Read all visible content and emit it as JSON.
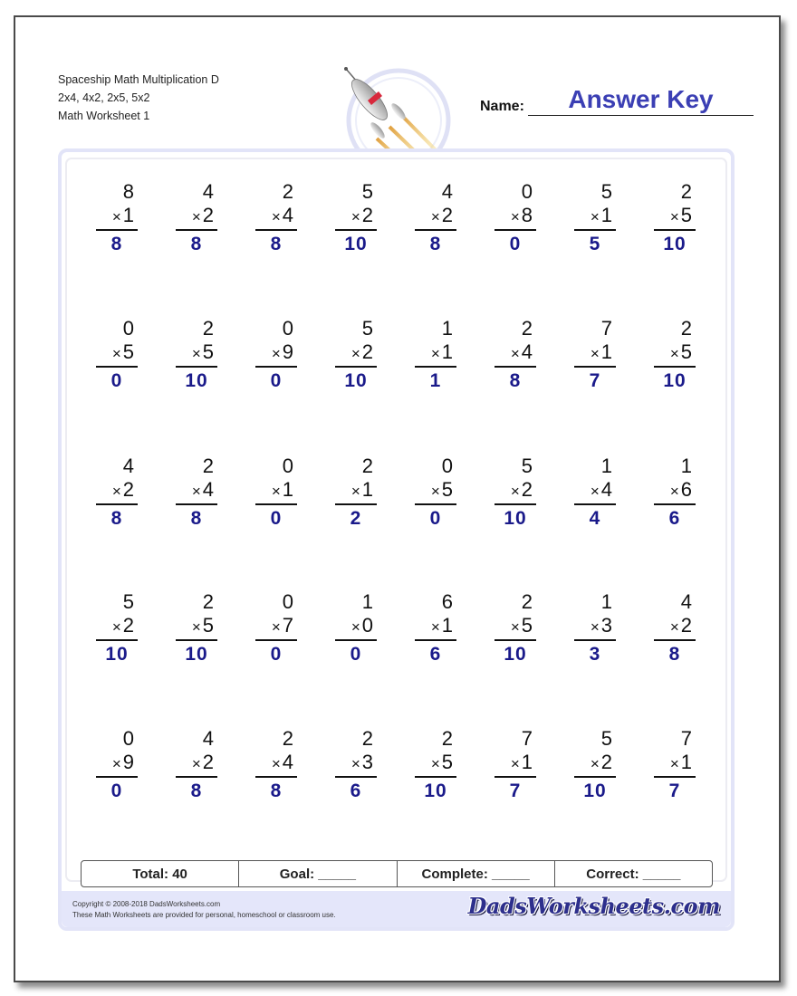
{
  "header": {
    "title": "Spaceship Math Multiplication D",
    "facts": "2x4, 4x2, 2x5, 5x2",
    "subtitle": "Math Worksheet 1",
    "name_label": "Name:",
    "name_value": "Answer Key"
  },
  "colors": {
    "answer": "#1a1a8a",
    "name_value": "#3b3fb4",
    "panel_border": "#e2e4f8",
    "footer_band": "#e4e6fa"
  },
  "operator": "×",
  "problems": [
    [
      {
        "a": "8",
        "b": "1",
        "ans": "8"
      },
      {
        "a": "4",
        "b": "2",
        "ans": "8"
      },
      {
        "a": "2",
        "b": "4",
        "ans": "8"
      },
      {
        "a": "5",
        "b": "2",
        "ans": "10"
      },
      {
        "a": "4",
        "b": "2",
        "ans": "8"
      },
      {
        "a": "0",
        "b": "8",
        "ans": "0"
      },
      {
        "a": "5",
        "b": "1",
        "ans": "5"
      },
      {
        "a": "2",
        "b": "5",
        "ans": "10"
      }
    ],
    [
      {
        "a": "0",
        "b": "5",
        "ans": "0"
      },
      {
        "a": "2",
        "b": "5",
        "ans": "10"
      },
      {
        "a": "0",
        "b": "9",
        "ans": "0"
      },
      {
        "a": "5",
        "b": "2",
        "ans": "10"
      },
      {
        "a": "1",
        "b": "1",
        "ans": "1"
      },
      {
        "a": "2",
        "b": "4",
        "ans": "8"
      },
      {
        "a": "7",
        "b": "1",
        "ans": "7"
      },
      {
        "a": "2",
        "b": "5",
        "ans": "10"
      }
    ],
    [
      {
        "a": "4",
        "b": "2",
        "ans": "8"
      },
      {
        "a": "2",
        "b": "4",
        "ans": "8"
      },
      {
        "a": "0",
        "b": "1",
        "ans": "0"
      },
      {
        "a": "2",
        "b": "1",
        "ans": "2"
      },
      {
        "a": "0",
        "b": "5",
        "ans": "0"
      },
      {
        "a": "5",
        "b": "2",
        "ans": "10"
      },
      {
        "a": "1",
        "b": "4",
        "ans": "4"
      },
      {
        "a": "1",
        "b": "6",
        "ans": "6"
      }
    ],
    [
      {
        "a": "5",
        "b": "2",
        "ans": "10"
      },
      {
        "a": "2",
        "b": "5",
        "ans": "10"
      },
      {
        "a": "0",
        "b": "7",
        "ans": "0"
      },
      {
        "a": "1",
        "b": "0",
        "ans": "0"
      },
      {
        "a": "6",
        "b": "1",
        "ans": "6"
      },
      {
        "a": "2",
        "b": "5",
        "ans": "10"
      },
      {
        "a": "1",
        "b": "3",
        "ans": "3"
      },
      {
        "a": "4",
        "b": "2",
        "ans": "8"
      }
    ],
    [
      {
        "a": "0",
        "b": "9",
        "ans": "0"
      },
      {
        "a": "4",
        "b": "2",
        "ans": "8"
      },
      {
        "a": "2",
        "b": "4",
        "ans": "8"
      },
      {
        "a": "2",
        "b": "3",
        "ans": "6"
      },
      {
        "a": "2",
        "b": "5",
        "ans": "10"
      },
      {
        "a": "7",
        "b": "1",
        "ans": "7"
      },
      {
        "a": "5",
        "b": "2",
        "ans": "10"
      },
      {
        "a": "7",
        "b": "1",
        "ans": "7"
      }
    ]
  ],
  "score": {
    "total": "Total: 40",
    "goal": "Goal: _____",
    "complete": "Complete: _____",
    "correct": "Correct: _____"
  },
  "footer": {
    "copyright": "Copyright © 2008-2018 DadsWorksheets.com",
    "usage": "These Math Worksheets are provided for personal, homeschool or classroom use.",
    "logo": "DadsWorksheets.com"
  },
  "icons": {
    "rocket": "rocket-icon"
  }
}
